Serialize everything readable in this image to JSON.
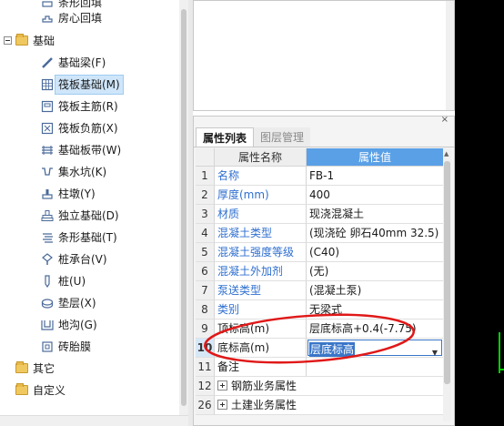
{
  "tree": {
    "items": [
      {
        "label": "条形回填",
        "icon": "partial-icon",
        "indent": 2
      },
      {
        "label": "房心回填",
        "icon": "backfill-icon",
        "indent": 2
      },
      {
        "label": "基础",
        "icon": "folder-icon",
        "indent": 0,
        "expanded": true
      },
      {
        "label": "基础梁(F)",
        "icon": "beam-icon",
        "indent": 2
      },
      {
        "label": "筏板基础(M)",
        "icon": "raft-foundation-icon",
        "indent": 2,
        "selected": true
      },
      {
        "label": "筏板主筋(R)",
        "icon": "main-rebar-icon",
        "indent": 2
      },
      {
        "label": "筏板负筋(X)",
        "icon": "negative-rebar-icon",
        "indent": 2
      },
      {
        "label": "基础板带(W)",
        "icon": "slab-strip-icon",
        "indent": 2
      },
      {
        "label": "集水坑(K)",
        "icon": "sump-pit-icon",
        "indent": 2
      },
      {
        "label": "柱墩(Y)",
        "icon": "column-pier-icon",
        "indent": 2
      },
      {
        "label": "独立基础(D)",
        "icon": "isolated-foundation-icon",
        "indent": 2
      },
      {
        "label": "条形基础(T)",
        "icon": "strip-foundation-icon",
        "indent": 2
      },
      {
        "label": "桩承台(V)",
        "icon": "pile-cap-icon",
        "indent": 2
      },
      {
        "label": "桩(U)",
        "icon": "pile-icon",
        "indent": 2
      },
      {
        "label": "垫层(X)",
        "icon": "cushion-icon",
        "indent": 2
      },
      {
        "label": "地沟(G)",
        "icon": "trench-icon",
        "indent": 2
      },
      {
        "label": "砖胎膜",
        "icon": "brick-mold-icon",
        "indent": 2
      },
      {
        "label": "其它",
        "icon": "folder-icon",
        "indent": 0,
        "expanded": false
      },
      {
        "label": "自定义",
        "icon": "folder-icon",
        "indent": 0,
        "expanded": false
      }
    ]
  },
  "properties": {
    "tabs": [
      {
        "label": "属性列表",
        "active": true
      },
      {
        "label": "图层管理",
        "active": false
      }
    ],
    "columns": {
      "name": "属性名称",
      "value": "属性值"
    },
    "rows": [
      {
        "num": "1",
        "name": "名称",
        "value": "FB-1",
        "name_color": "blue"
      },
      {
        "num": "2",
        "name": "厚度(mm)",
        "value": "400",
        "name_color": "blue"
      },
      {
        "num": "3",
        "name": "材质",
        "value": "现浇混凝土",
        "name_color": "blue"
      },
      {
        "num": "4",
        "name": "混凝土类型",
        "value": "(现浇砼 卵石40mm 32.5)",
        "name_color": "blue"
      },
      {
        "num": "5",
        "name": "混凝土强度等级",
        "value": "(C40)",
        "name_color": "blue"
      },
      {
        "num": "6",
        "name": "混凝土外加剂",
        "value": "(无)",
        "name_color": "blue"
      },
      {
        "num": "7",
        "name": "泵送类型",
        "value": "(混凝土泵)",
        "name_color": "blue"
      },
      {
        "num": "8",
        "name": "类别",
        "value": "无梁式",
        "name_color": "blue"
      },
      {
        "num": "9",
        "name": "顶标高(m)",
        "value": "层底标高+0.4(-7.75)",
        "name_color": "black"
      },
      {
        "num": "10",
        "name": "底标高(m)",
        "value": "层底标高",
        "name_color": "black",
        "editing": true
      },
      {
        "num": "11",
        "name": "备注",
        "value": "",
        "name_color": "black"
      },
      {
        "num": "12",
        "name": "钢筋业务属性",
        "value": "",
        "name_color": "black",
        "group": true
      },
      {
        "num": "26",
        "name": "土建业务属性",
        "value": "",
        "name_color": "black",
        "group": true
      }
    ]
  },
  "colors": {
    "header_value_bg": "#5aa0e6",
    "name_blue": "#2f6fd0",
    "annotation_red": "#e01818",
    "axis_green": "#00d000"
  }
}
